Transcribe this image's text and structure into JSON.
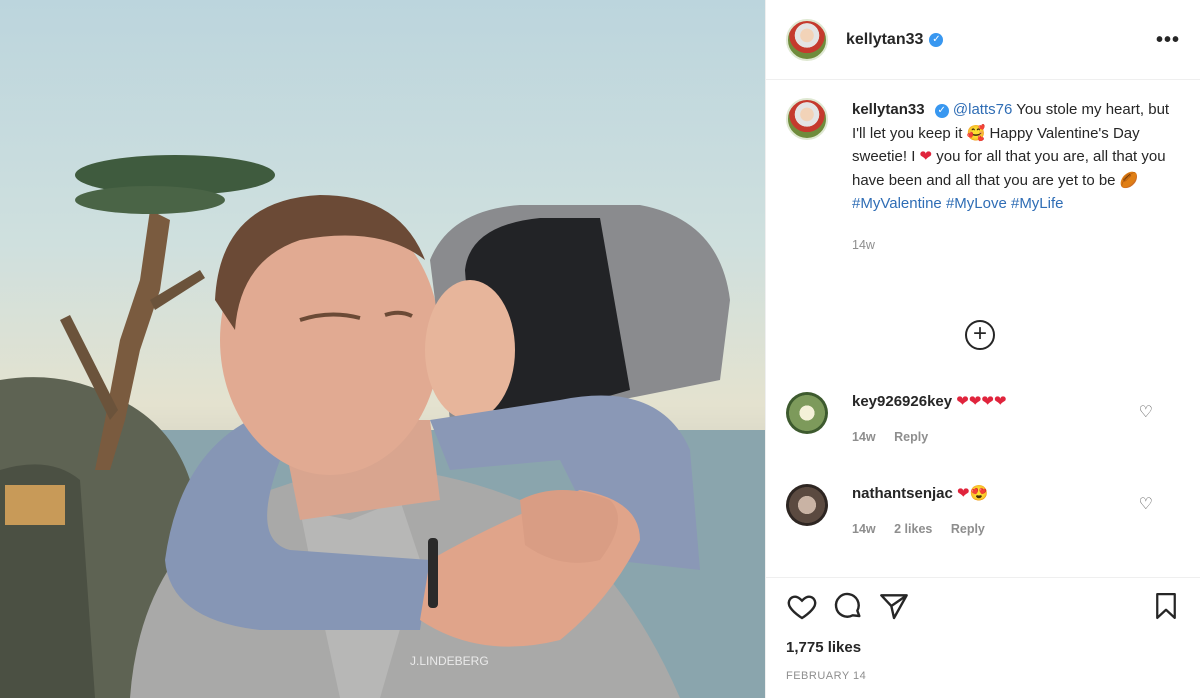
{
  "post": {
    "username": "kellytan33",
    "more_label": "•••",
    "caption": {
      "mention": "@latts76",
      "line1": " You stole my heart, but I'll let you keep it ",
      "line2": " Happy Valentine's Day sweetie! I ",
      "line3": " you for all that you are, all that you have been and all that you are yet to be ",
      "hashtags": "#MyValentine #MyLove #MyLife",
      "time": "14w"
    },
    "load_more_label": "+",
    "comments": [
      {
        "username": "key926926key",
        "text": "❤❤❤❤",
        "time": "14w",
        "likes": "",
        "reply": "Reply"
      },
      {
        "username": "nathantsenjac",
        "text": "❤",
        "time": "14w",
        "likes": "2 likes",
        "reply": "Reply"
      }
    ],
    "likes": "1,775 likes",
    "date": "FEBRUARY 14",
    "photo_text": "J.LINDEBERG"
  },
  "colors": {
    "verified": "#3897f0",
    "link": "#2f6db5",
    "heart": "#e0243c"
  },
  "icons": [
    "verified-icon",
    "more-icon",
    "plus-icon",
    "heart-icon",
    "comment-icon",
    "share-icon",
    "bookmark-icon"
  ]
}
